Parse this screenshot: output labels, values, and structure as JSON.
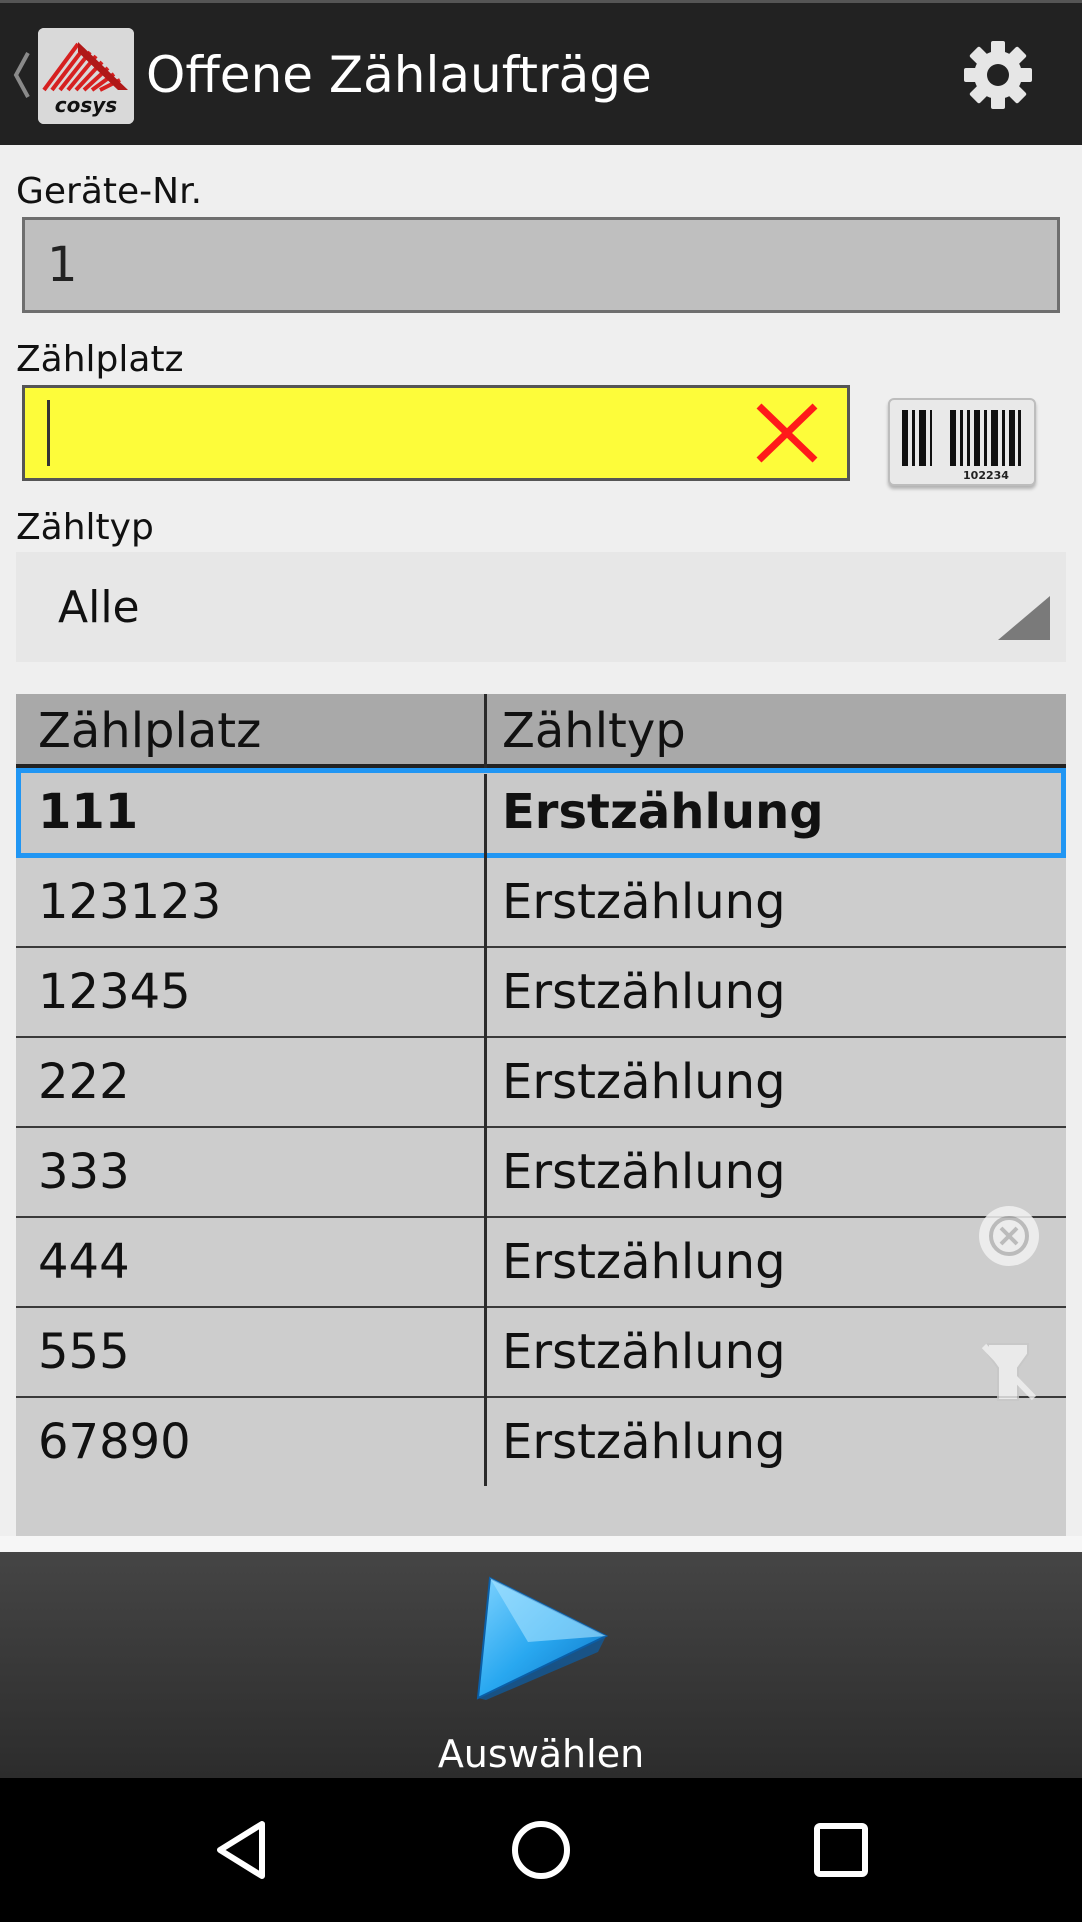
{
  "header": {
    "title": "Offene Zählaufträge",
    "logo_text": "cosys"
  },
  "form": {
    "geraete_label": "Geräte-Nr.",
    "geraete_value": "1",
    "zaehlplatz_label": "Zählplatz",
    "zaehlplatz_value": "",
    "barcode_number": "102234",
    "zaehltyp_label": "Zähltyp",
    "zaehltyp_selected": "Alle"
  },
  "table": {
    "columns": [
      "Zählplatz",
      "Zähltyp"
    ],
    "rows": [
      {
        "zaehlplatz": "111",
        "zaehltyp": "Erstzählung",
        "selected": true
      },
      {
        "zaehlplatz": "123123",
        "zaehltyp": "Erstzählung"
      },
      {
        "zaehlplatz": "12345",
        "zaehltyp": "Erstzählung"
      },
      {
        "zaehlplatz": "222",
        "zaehltyp": "Erstzählung"
      },
      {
        "zaehlplatz": "333",
        "zaehltyp": "Erstzählung"
      },
      {
        "zaehlplatz": "444",
        "zaehltyp": "Erstzählung"
      },
      {
        "zaehlplatz": "555",
        "zaehltyp": "Erstzählung"
      },
      {
        "zaehlplatz": "67890",
        "zaehltyp": "Erstzählung"
      }
    ]
  },
  "bottom_bar": {
    "select_label": "Auswählen"
  },
  "icons": {
    "settings": "gear-icon",
    "clear": "close-icon",
    "barcode": "barcode-icon",
    "select": "play-icon",
    "nav_back": "back-triangle-icon",
    "nav_home": "home-circle-icon",
    "nav_recents": "recents-square-icon"
  },
  "colors": {
    "actionbar": "#222222",
    "input_highlight": "#fdfc3a",
    "selection": "#2196f3",
    "clear_x": "#ff1a1a"
  }
}
